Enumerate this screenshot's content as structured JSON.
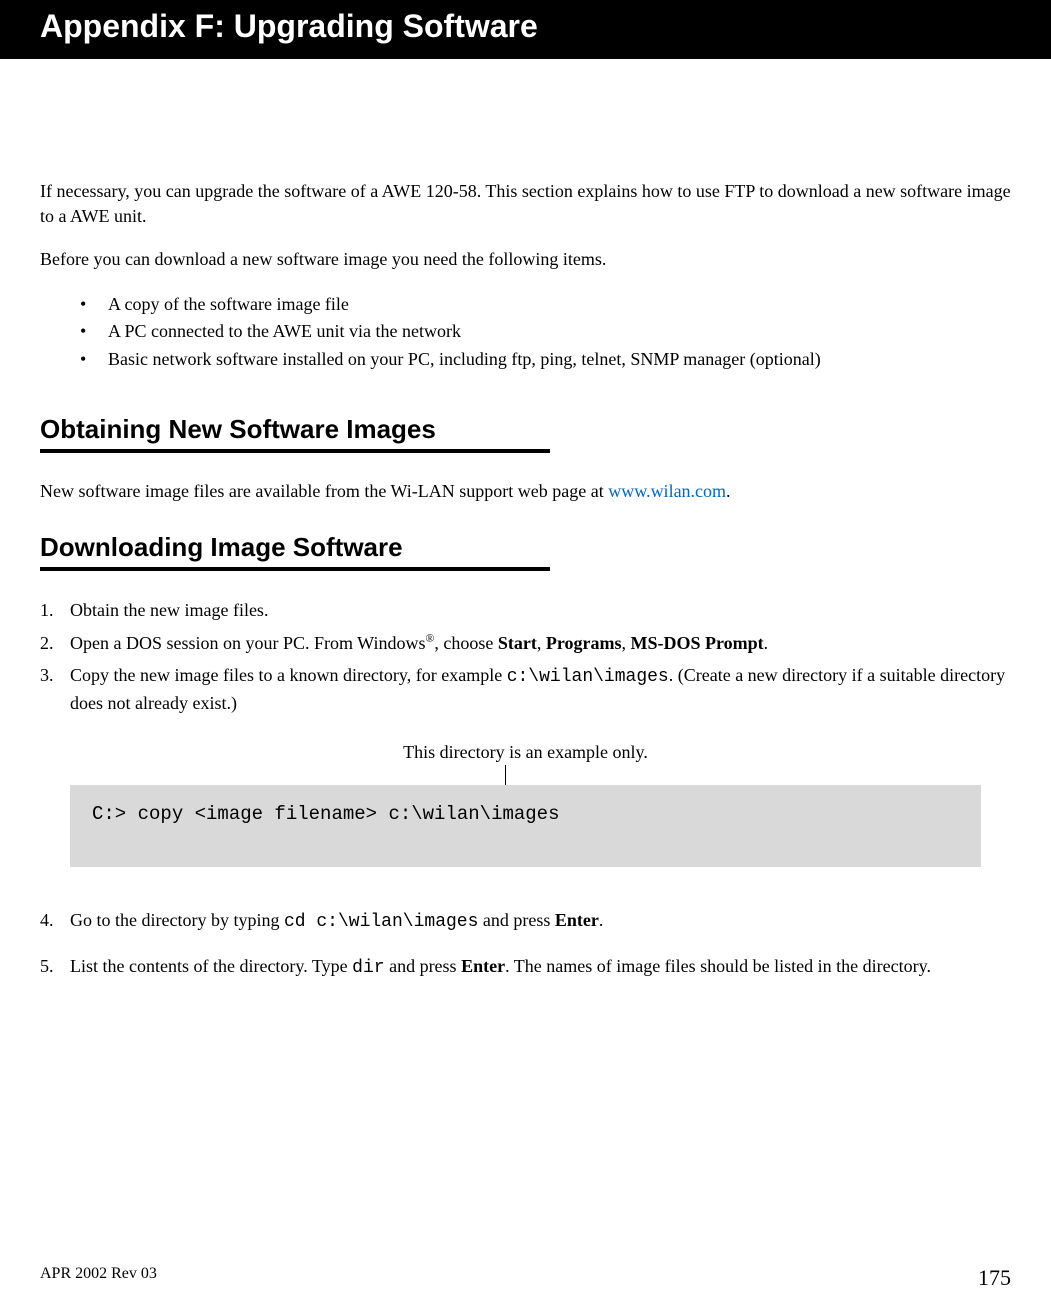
{
  "header": {
    "title": "Appendix F: Upgrading Software"
  },
  "intro": {
    "p1": "If necessary, you can upgrade the software of a AWE 120-58. This section explains how to use FTP to download a new software image to a AWE unit.",
    "p2": "Before you can download a new software image you need the following items.",
    "bullets": [
      "A copy of the software image file",
      "A PC connected to the AWE unit via the network",
      "Basic network software installed on your PC, including ftp, ping, telnet, SNMP manager (optional)"
    ]
  },
  "section1": {
    "title": "Obtaining New Software Images",
    "body_prefix": "New software image files are available from the Wi-LAN support web page at ",
    "link": "www.wilan.com",
    "body_suffix": "."
  },
  "section2": {
    "title": "Downloading Image Software",
    "steps": {
      "s1": "Obtain the new image files.",
      "s2_a": "Open a DOS session on your PC. From Windows",
      "s2_reg": "®",
      "s2_b": ", choose ",
      "s2_start": "Start",
      "s2_c": ", ",
      "s2_programs": "Programs",
      "s2_d": ", ",
      "s2_msdos": "MS-DOS Prompt",
      "s2_e": ".",
      "s3_a": "Copy the new image files to a known directory, for example ",
      "s3_mono": "c:\\wilan\\images",
      "s3_b": ". (Create a new directory if a suitable directory does not already exist.)",
      "example_label": "This directory is an example only.",
      "code": "C:> copy <image filename> c:\\wilan\\images",
      "s4_a": "Go to the directory by typing  ",
      "s4_mono": "cd c:\\wilan\\images",
      "s4_b": " and press ",
      "s4_enter": "Enter",
      "s4_c": ".",
      "s5_a": "List the contents of the directory. Type ",
      "s5_mono": "dir",
      "s5_b": " and press ",
      "s5_enter": "Enter",
      "s5_c": ". The names of image files should be listed in the directory."
    }
  },
  "footer": {
    "left": "APR 2002 Rev 03",
    "right": "175"
  }
}
